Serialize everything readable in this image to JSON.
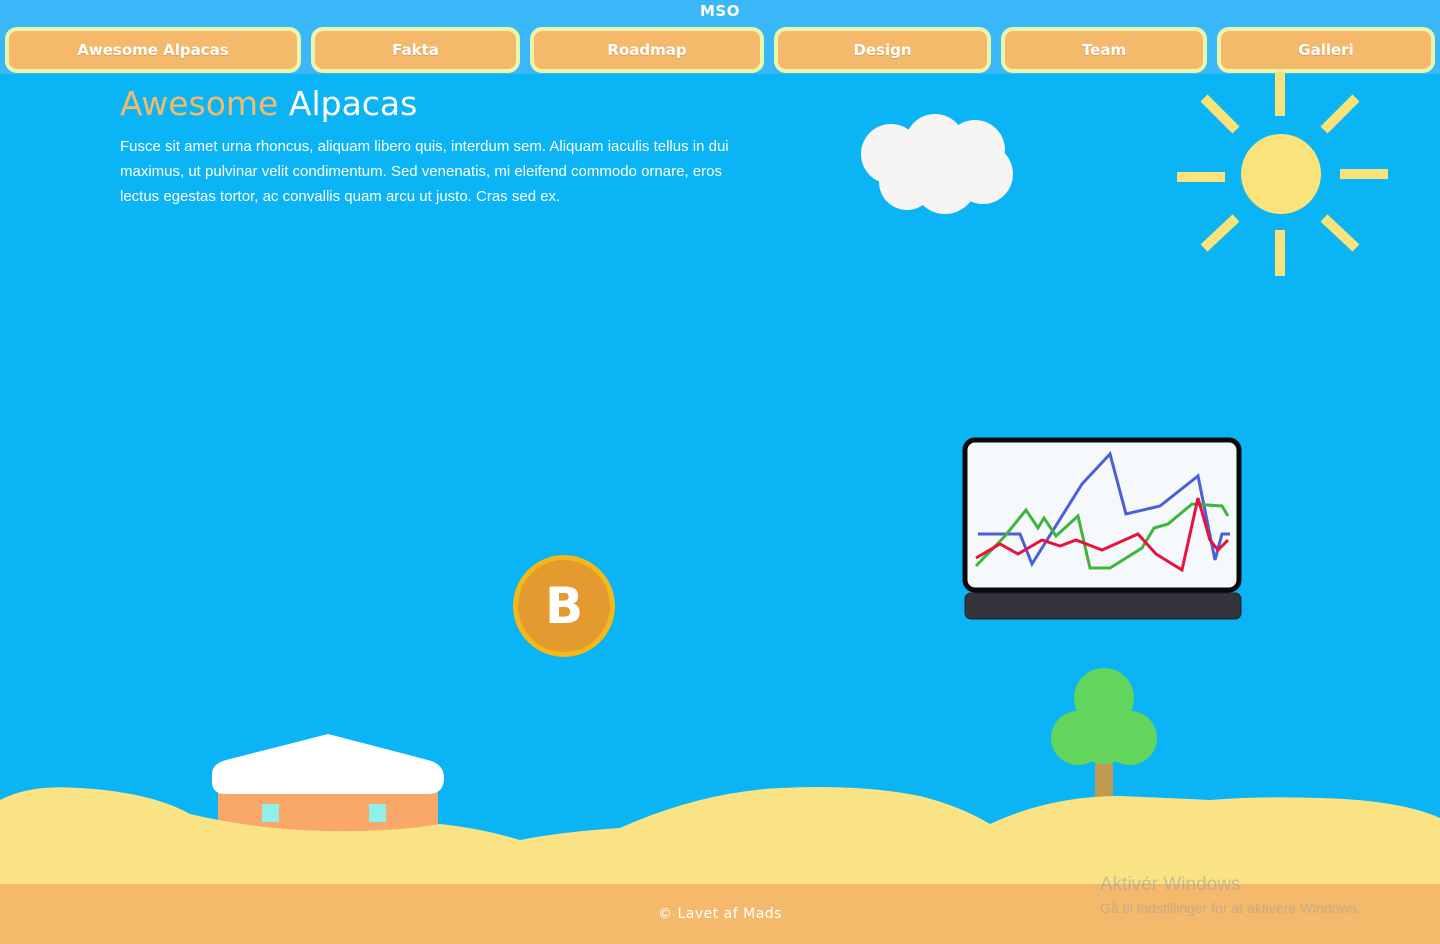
{
  "header": {
    "brand": "MSO",
    "nav": [
      {
        "label": "Awesome Alpacas"
      },
      {
        "label": "Fakta"
      },
      {
        "label": "Roadmap"
      },
      {
        "label": "Design"
      },
      {
        "label": "Team"
      },
      {
        "label": "Galleri"
      }
    ]
  },
  "hero": {
    "title_accent": "Awesome",
    "title_rest": "Alpacas",
    "text": "Fusce sit amet urna rhoncus, aliquam libero quis, interdum sem. Aliquam iaculis tellus in dui maximus, ut pulvinar velit condimentum. Sed venenatis, mi eleifend commodo ornare, eros lectus egestas tortor, ac convallis quam arcu ut justo. Cras sed ex."
  },
  "illustration": {
    "coin_letter": "B"
  },
  "footer": {
    "text": "© Lavet af Mads"
  },
  "windows_watermark": {
    "title": "Aktivér Windows",
    "subtitle": "Gå til Indstillinger for at aktivere Windows."
  },
  "colors": {
    "sky": "#0bb4f4",
    "header": "#39b7f8",
    "accent": "#f4b96b",
    "button_border": "#eaf7a8",
    "sand": "#f9e384",
    "sun": "#f9e37a",
    "coin": "#e39b30",
    "tree_leaves": "#62d65c"
  }
}
